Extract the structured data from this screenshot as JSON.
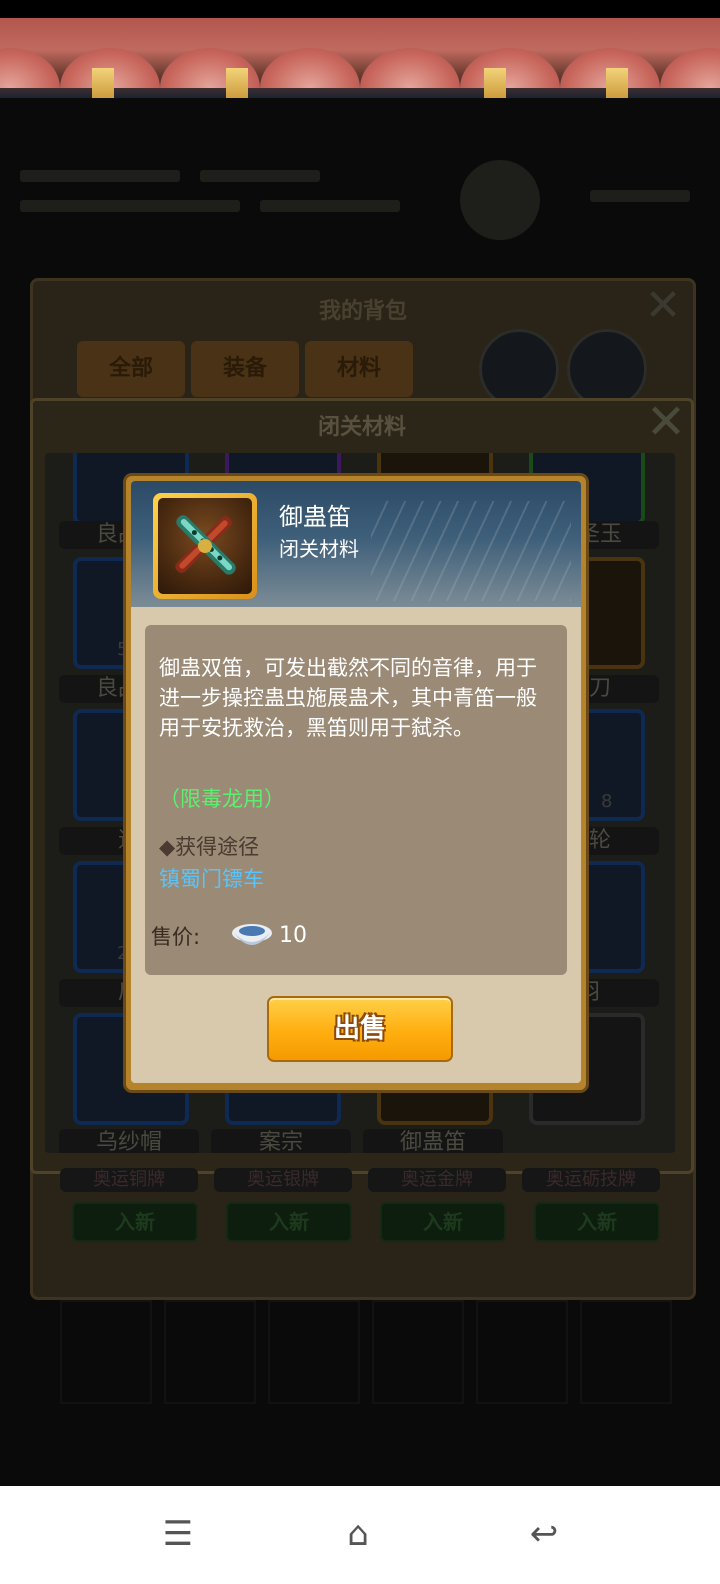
{
  "background": {
    "bag_title": "我的背包",
    "bag_tabs": [
      "全部",
      "装备",
      "材料"
    ],
    "material_title": "闭关材料",
    "grid_labels": [
      "良品丹",
      "",
      "",
      "截圣玉",
      "良品丹",
      "",
      "",
      "明刀",
      "道",
      "",
      "",
      "齿轮",
      "肩",
      "",
      "",
      "羽",
      "乌纱帽",
      "案宗",
      "御蛊笛",
      ""
    ],
    "grid_counts": [
      "5",
      "",
      "",
      "8",
      "2",
      "",
      "",
      ""
    ],
    "lower_labels": [
      "奥运铜牌",
      "奥运银牌",
      "奥运金牌",
      "奥运砺技牌"
    ],
    "lower_buttons": [
      "入新",
      "入新",
      "入新",
      "入新"
    ]
  },
  "popup": {
    "item_name": "御蛊笛",
    "item_type": "闭关材料",
    "description": "御蛊双笛，可发出截然不同的音律，用于进一步操控蛊虫施展蛊术，其中青笛一般用于安抚救治，黑笛则用于弑杀。",
    "restriction": "（限毒龙用）",
    "source_heading": "◆获得途径",
    "source_link": "镇蜀门镖车",
    "price_label": "售价:",
    "price_value": "10",
    "sell_button": "出售"
  },
  "nav": {
    "menu_icon": "☰",
    "home_icon": "⌂",
    "back_icon": "↩"
  },
  "colors": {
    "popup_border": "#b4832c",
    "restriction": "#5cf06e",
    "link": "#5ac4f8",
    "sell_button": "#ffae10"
  }
}
